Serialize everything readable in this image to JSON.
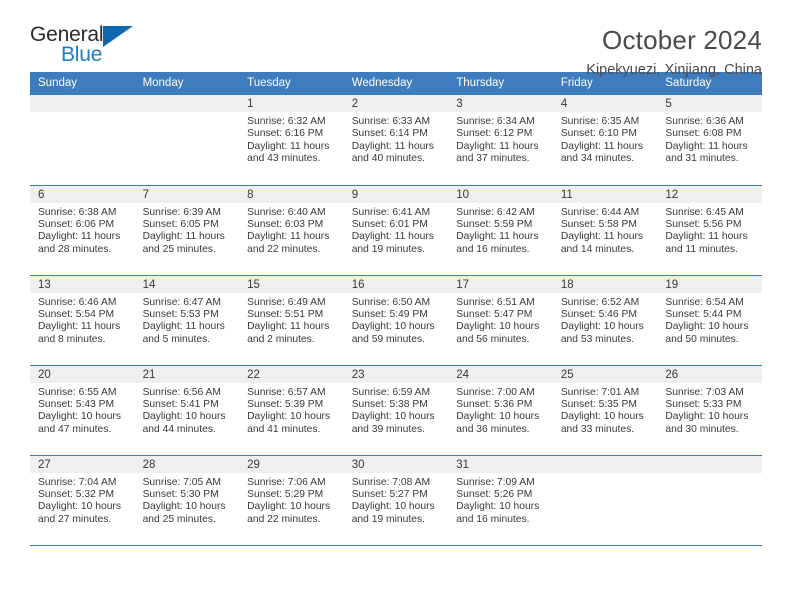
{
  "brand": {
    "name_part1": "General",
    "name_part2": "Blue",
    "accent_color": "#1f7fc4",
    "triangle_color": "#0f68ad"
  },
  "header": {
    "title": "October 2024",
    "location": "Kipekyuezi, Xinjiang, China"
  },
  "calendar": {
    "header_bg": "#3e7cbd",
    "daynum_bg": "#efefef",
    "weekdays": [
      "Sunday",
      "Monday",
      "Tuesday",
      "Wednesday",
      "Thursday",
      "Friday",
      "Saturday"
    ],
    "weeks": [
      [
        {
          "day": "",
          "sunrise": "",
          "sunset": "",
          "daylight": ""
        },
        {
          "day": "",
          "sunrise": "",
          "sunset": "",
          "daylight": ""
        },
        {
          "day": "1",
          "sunrise": "Sunrise: 6:32 AM",
          "sunset": "Sunset: 6:16 PM",
          "daylight": "Daylight: 11 hours and 43 minutes."
        },
        {
          "day": "2",
          "sunrise": "Sunrise: 6:33 AM",
          "sunset": "Sunset: 6:14 PM",
          "daylight": "Daylight: 11 hours and 40 minutes."
        },
        {
          "day": "3",
          "sunrise": "Sunrise: 6:34 AM",
          "sunset": "Sunset: 6:12 PM",
          "daylight": "Daylight: 11 hours and 37 minutes."
        },
        {
          "day": "4",
          "sunrise": "Sunrise: 6:35 AM",
          "sunset": "Sunset: 6:10 PM",
          "daylight": "Daylight: 11 hours and 34 minutes."
        },
        {
          "day": "5",
          "sunrise": "Sunrise: 6:36 AM",
          "sunset": "Sunset: 6:08 PM",
          "daylight": "Daylight: 11 hours and 31 minutes."
        }
      ],
      [
        {
          "day": "6",
          "sunrise": "Sunrise: 6:38 AM",
          "sunset": "Sunset: 6:06 PM",
          "daylight": "Daylight: 11 hours and 28 minutes."
        },
        {
          "day": "7",
          "sunrise": "Sunrise: 6:39 AM",
          "sunset": "Sunset: 6:05 PM",
          "daylight": "Daylight: 11 hours and 25 minutes."
        },
        {
          "day": "8",
          "sunrise": "Sunrise: 6:40 AM",
          "sunset": "Sunset: 6:03 PM",
          "daylight": "Daylight: 11 hours and 22 minutes."
        },
        {
          "day": "9",
          "sunrise": "Sunrise: 6:41 AM",
          "sunset": "Sunset: 6:01 PM",
          "daylight": "Daylight: 11 hours and 19 minutes."
        },
        {
          "day": "10",
          "sunrise": "Sunrise: 6:42 AM",
          "sunset": "Sunset: 5:59 PM",
          "daylight": "Daylight: 11 hours and 16 minutes."
        },
        {
          "day": "11",
          "sunrise": "Sunrise: 6:44 AM",
          "sunset": "Sunset: 5:58 PM",
          "daylight": "Daylight: 11 hours and 14 minutes."
        },
        {
          "day": "12",
          "sunrise": "Sunrise: 6:45 AM",
          "sunset": "Sunset: 5:56 PM",
          "daylight": "Daylight: 11 hours and 11 minutes."
        }
      ],
      [
        {
          "day": "13",
          "sunrise": "Sunrise: 6:46 AM",
          "sunset": "Sunset: 5:54 PM",
          "daylight": "Daylight: 11 hours and 8 minutes."
        },
        {
          "day": "14",
          "sunrise": "Sunrise: 6:47 AM",
          "sunset": "Sunset: 5:53 PM",
          "daylight": "Daylight: 11 hours and 5 minutes."
        },
        {
          "day": "15",
          "sunrise": "Sunrise: 6:49 AM",
          "sunset": "Sunset: 5:51 PM",
          "daylight": "Daylight: 11 hours and 2 minutes."
        },
        {
          "day": "16",
          "sunrise": "Sunrise: 6:50 AM",
          "sunset": "Sunset: 5:49 PM",
          "daylight": "Daylight: 10 hours and 59 minutes."
        },
        {
          "day": "17",
          "sunrise": "Sunrise: 6:51 AM",
          "sunset": "Sunset: 5:47 PM",
          "daylight": "Daylight: 10 hours and 56 minutes."
        },
        {
          "day": "18",
          "sunrise": "Sunrise: 6:52 AM",
          "sunset": "Sunset: 5:46 PM",
          "daylight": "Daylight: 10 hours and 53 minutes."
        },
        {
          "day": "19",
          "sunrise": "Sunrise: 6:54 AM",
          "sunset": "Sunset: 5:44 PM",
          "daylight": "Daylight: 10 hours and 50 minutes."
        }
      ],
      [
        {
          "day": "20",
          "sunrise": "Sunrise: 6:55 AM",
          "sunset": "Sunset: 5:43 PM",
          "daylight": "Daylight: 10 hours and 47 minutes."
        },
        {
          "day": "21",
          "sunrise": "Sunrise: 6:56 AM",
          "sunset": "Sunset: 5:41 PM",
          "daylight": "Daylight: 10 hours and 44 minutes."
        },
        {
          "day": "22",
          "sunrise": "Sunrise: 6:57 AM",
          "sunset": "Sunset: 5:39 PM",
          "daylight": "Daylight: 10 hours and 41 minutes."
        },
        {
          "day": "23",
          "sunrise": "Sunrise: 6:59 AM",
          "sunset": "Sunset: 5:38 PM",
          "daylight": "Daylight: 10 hours and 39 minutes."
        },
        {
          "day": "24",
          "sunrise": "Sunrise: 7:00 AM",
          "sunset": "Sunset: 5:36 PM",
          "daylight": "Daylight: 10 hours and 36 minutes."
        },
        {
          "day": "25",
          "sunrise": "Sunrise: 7:01 AM",
          "sunset": "Sunset: 5:35 PM",
          "daylight": "Daylight: 10 hours and 33 minutes."
        },
        {
          "day": "26",
          "sunrise": "Sunrise: 7:03 AM",
          "sunset": "Sunset: 5:33 PM",
          "daylight": "Daylight: 10 hours and 30 minutes."
        }
      ],
      [
        {
          "day": "27",
          "sunrise": "Sunrise: 7:04 AM",
          "sunset": "Sunset: 5:32 PM",
          "daylight": "Daylight: 10 hours and 27 minutes."
        },
        {
          "day": "28",
          "sunrise": "Sunrise: 7:05 AM",
          "sunset": "Sunset: 5:30 PM",
          "daylight": "Daylight: 10 hours and 25 minutes."
        },
        {
          "day": "29",
          "sunrise": "Sunrise: 7:06 AM",
          "sunset": "Sunset: 5:29 PM",
          "daylight": "Daylight: 10 hours and 22 minutes."
        },
        {
          "day": "30",
          "sunrise": "Sunrise: 7:08 AM",
          "sunset": "Sunset: 5:27 PM",
          "daylight": "Daylight: 10 hours and 19 minutes."
        },
        {
          "day": "31",
          "sunrise": "Sunrise: 7:09 AM",
          "sunset": "Sunset: 5:26 PM",
          "daylight": "Daylight: 10 hours and 16 minutes."
        },
        {
          "day": "",
          "sunrise": "",
          "sunset": "",
          "daylight": ""
        },
        {
          "day": "",
          "sunrise": "",
          "sunset": "",
          "daylight": ""
        }
      ]
    ]
  }
}
